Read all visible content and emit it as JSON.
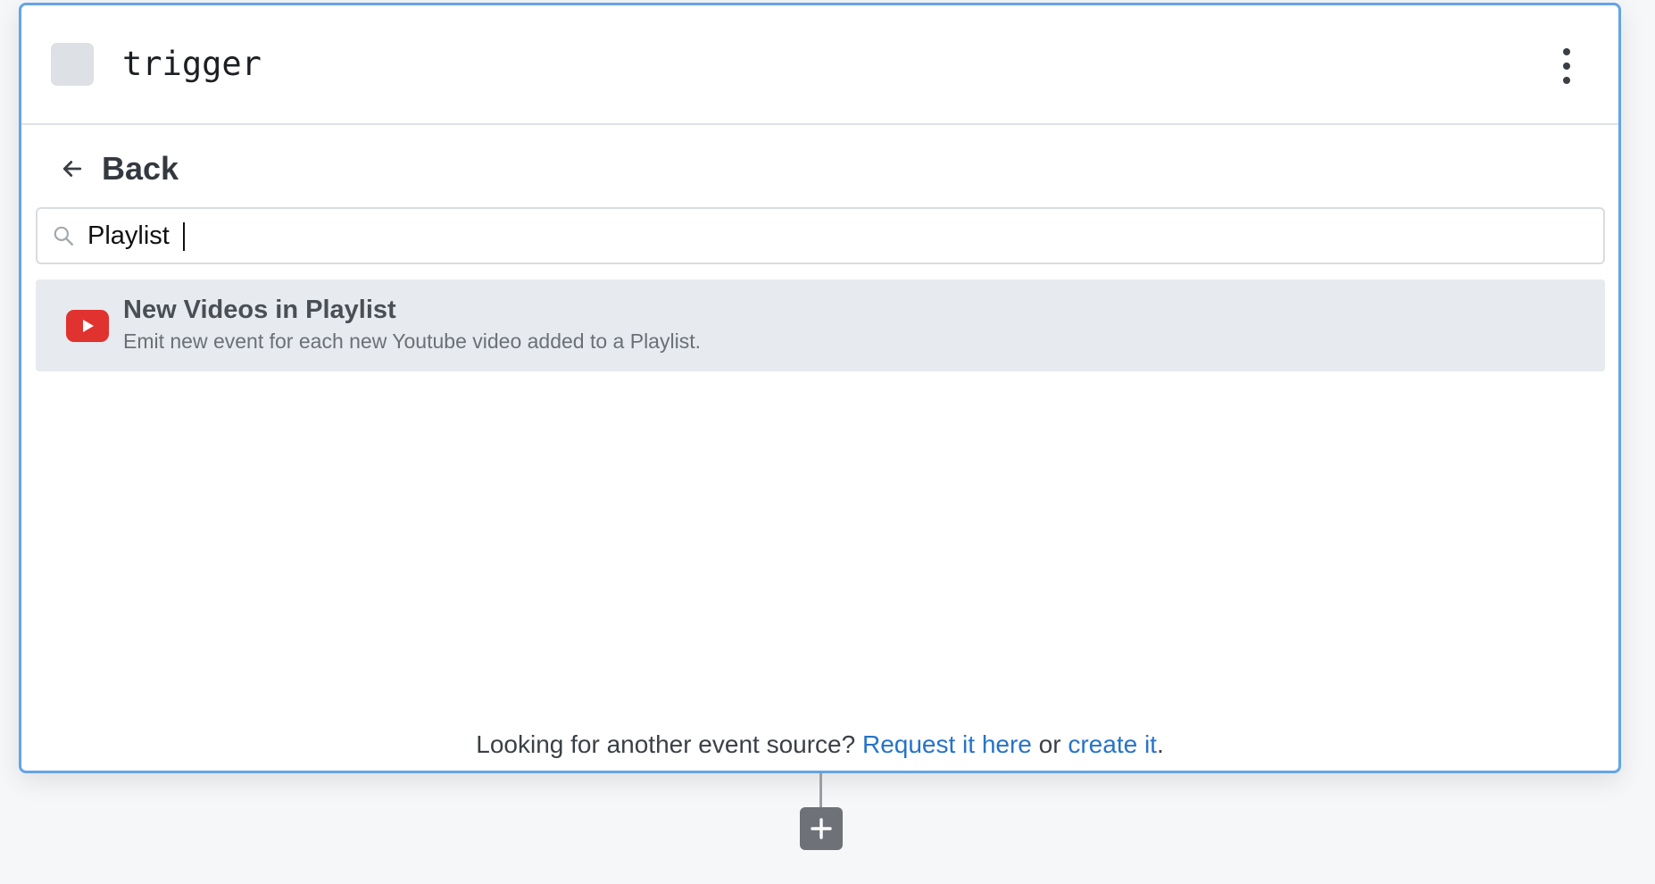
{
  "step": {
    "name": "trigger"
  },
  "navigation": {
    "back_label": "Back"
  },
  "search": {
    "value": "Playlist",
    "placeholder": ""
  },
  "results": [
    {
      "app_icon": "youtube-icon",
      "title": "New Videos in Playlist",
      "description": "Emit new event for each new Youtube video added to a Playlist."
    }
  ],
  "footer": {
    "prompt": "Looking for another event source?",
    "request_link": "Request it here",
    "or_text": "or",
    "create_link": "create it",
    "end_punct": "."
  },
  "icons": {
    "menu": "more-vertical-icon",
    "back": "arrow-left-icon",
    "search": "search-icon",
    "add": "plus-icon"
  },
  "colors": {
    "card_border": "#63a4e8",
    "link": "#2673c9",
    "youtube_red": "#e0322f",
    "result_highlight": "#e7eaee"
  }
}
